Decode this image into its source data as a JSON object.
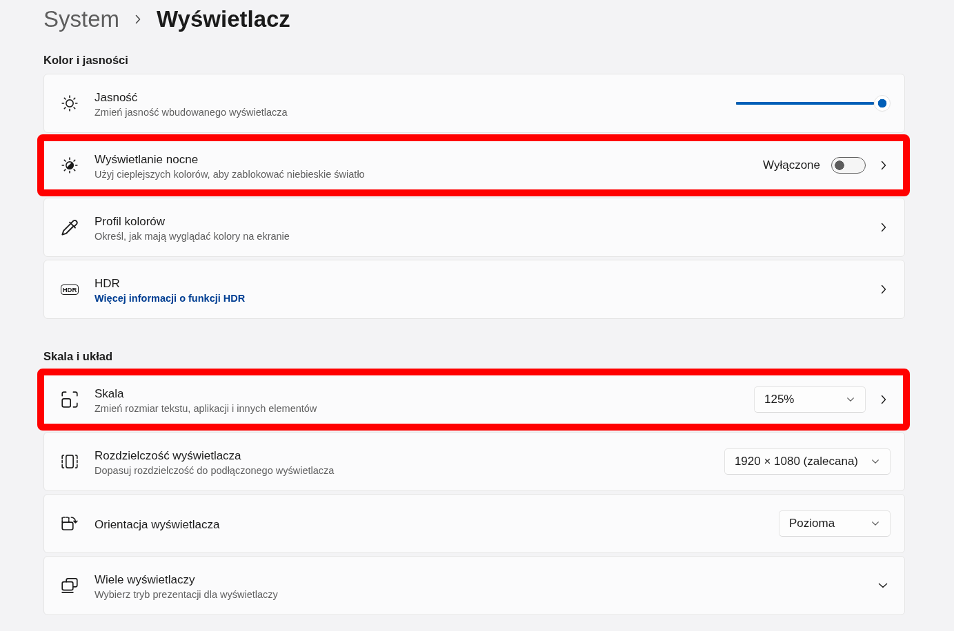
{
  "breadcrumb": [
    {
      "label": "System",
      "current": false
    },
    {
      "label": "Wyświetlacz",
      "current": true
    }
  ],
  "sections": [
    {
      "heading": "Kolor i jasności",
      "rows": [
        {
          "kind": "slider",
          "title": "Jasność",
          "subtitle": "Zmień jasność wbudowanego wyświetlacza",
          "level": 1,
          "opens_page": false,
          "highlighted": false
        },
        {
          "kind": "toggle",
          "title": "Wyświetlanie nocne",
          "subtitle": "Użyj cieplejszych kolorów, aby zablokować niebieskie światło",
          "status": "Wyłączone",
          "on": false,
          "opens_page": true,
          "highlighted": true
        },
        {
          "kind": "navigate",
          "title": "Profil kolorów",
          "subtitle": "Określ, jak mają wyglądać kolory na ekranie",
          "opens_page": true,
          "highlighted": false
        },
        {
          "kind": "navigate",
          "badge": "HDR",
          "title": "HDR",
          "link": "Więcej informacji o funkcji HDR",
          "opens_page": true,
          "highlighted": false
        }
      ]
    },
    {
      "heading": "Skala i układ",
      "rows": [
        {
          "kind": "dropdown",
          "title": "Skala",
          "subtitle": "Zmień rozmiar tekstu, aplikacji i innych elementów",
          "value": "125%",
          "opens_page": true,
          "highlighted": true
        },
        {
          "kind": "dropdown",
          "title": "Rozdzielczość wyświetlacza",
          "subtitle": "Dopasuj rozdzielczość do podłączonego wyświetlacza",
          "value": "1920 × 1080 (zalecana)",
          "opens_page": false,
          "highlighted": false
        },
        {
          "kind": "dropdown",
          "title": "Orientacja wyświetlacza",
          "value": "Pozioma",
          "opens_page": false,
          "highlighted": false
        },
        {
          "kind": "expander",
          "title": "Wiele wyświetlaczy",
          "subtitle": "Wybierz tryb prezentacji dla wyświetlaczy",
          "expanded": false,
          "highlighted": false
        }
      ]
    }
  ]
}
